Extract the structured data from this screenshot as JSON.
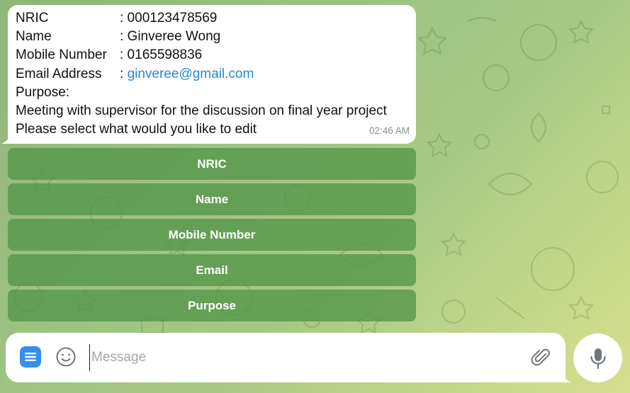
{
  "message": {
    "fields": [
      {
        "key": "NRIC",
        "value": ": 000123478569"
      },
      {
        "key": "Name",
        "value": ": Ginveree Wong"
      },
      {
        "key": "Mobile Number",
        "value": ": 0165598836"
      },
      {
        "key": "Email Address",
        "value_prefix": ": ",
        "value_link": "ginveree@gmail.com"
      }
    ],
    "purpose_label": "Purpose:",
    "purpose_text": "Meeting with supervisor for the discussion on final year project",
    "prompt": "Please select what would you like to edit",
    "time": "02:46 AM"
  },
  "keyboard": {
    "buttons": [
      "NRIC",
      "Name",
      "Mobile Number",
      "Email",
      "Purpose"
    ]
  },
  "composer": {
    "placeholder": "Message"
  },
  "icons": {
    "menu": "menu-icon",
    "emoji": "smiley-icon",
    "attach": "paperclip-icon",
    "mic": "microphone-icon"
  },
  "colors": {
    "accent": "#3390ec",
    "link": "#2a88d8",
    "keyboard_button": "#529648"
  }
}
